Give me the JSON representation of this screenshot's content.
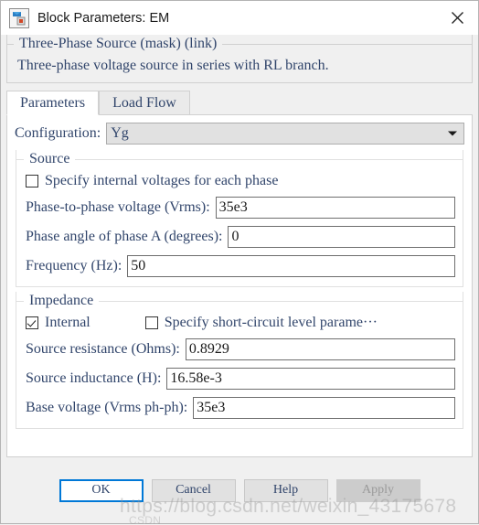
{
  "window": {
    "title": "Block Parameters: EM",
    "icon": "simulink-block-icon",
    "close_icon": "close-icon"
  },
  "description": {
    "heading": "Three-Phase Source (mask) (link)",
    "body": "Three-phase voltage source in series with RL branch."
  },
  "tabs": [
    {
      "label": "Parameters",
      "active": true
    },
    {
      "label": "Load Flow",
      "active": false
    }
  ],
  "configuration": {
    "label": "Configuration:",
    "value": "Yg",
    "arrow_icon": "chevron-down-icon"
  },
  "source_group": {
    "title": "Source",
    "specify_internal": {
      "label": "Specify internal voltages for each phase",
      "checked": false
    },
    "fields": [
      {
        "label": "Phase-to-phase voltage (Vrms):",
        "value": "35e3"
      },
      {
        "label": "Phase angle of phase A (degrees):",
        "value": "0"
      },
      {
        "label": "Frequency (Hz):",
        "value": "50"
      }
    ]
  },
  "impedance_group": {
    "title": "Impedance",
    "internal": {
      "label": "Internal",
      "checked": true
    },
    "specify_short_circuit": {
      "label": "Specify short-circuit level parame···",
      "checked": false
    },
    "fields": [
      {
        "label": "Source resistance (Ohms):",
        "value": "0.8929"
      },
      {
        "label": "Source inductance (H):",
        "value": "16.58e-3"
      },
      {
        "label": "Base voltage (Vrms ph-ph):",
        "value": "35e3"
      }
    ]
  },
  "buttons": [
    {
      "label": "OK",
      "state": "primary"
    },
    {
      "label": "Cancel",
      "state": "normal"
    },
    {
      "label": "Help",
      "state": "normal"
    },
    {
      "label": "Apply",
      "state": "disabled"
    }
  ],
  "watermark": {
    "line1": "https://blog.csdn.net/weixin_43175678",
    "line2": "CSDN"
  },
  "colors": {
    "accent": "#0078d7",
    "text": "#31456b",
    "dialog_bg": "#f0f0f0",
    "panel_bg": "#ffffff"
  }
}
